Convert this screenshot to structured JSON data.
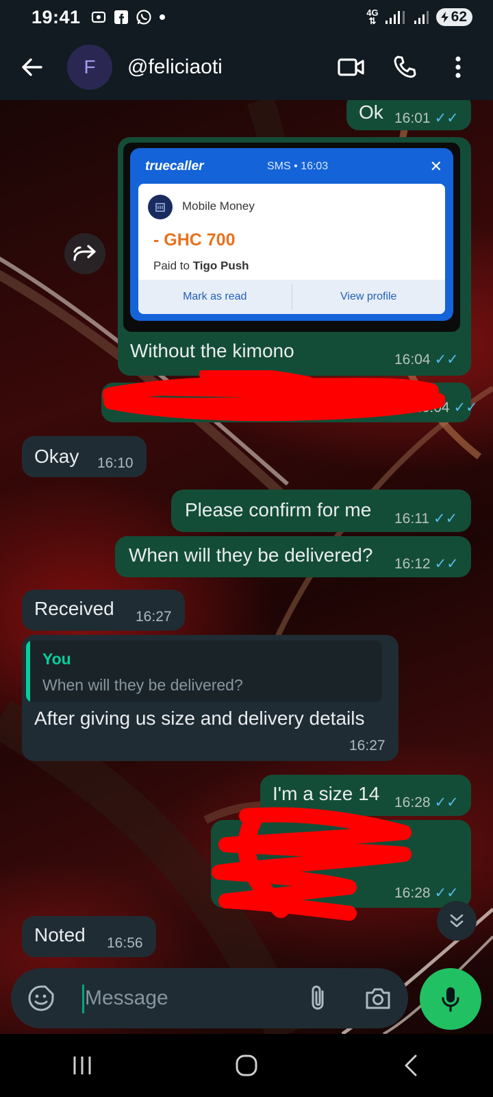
{
  "status_bar": {
    "time": "19:41",
    "network": "4G",
    "battery": "62"
  },
  "header": {
    "avatar_initial": "F",
    "contact": "@feliciaoti"
  },
  "messages": [
    {
      "id": "m1",
      "dir": "out",
      "text": "Ok",
      "time": "16:01",
      "ticks": "✓✓"
    },
    {
      "id": "m2",
      "dir": "out",
      "text": "Without the kimono",
      "time": "16:04",
      "ticks": "✓✓",
      "attachment": {
        "app": "truecaller",
        "meta": "SMS • 16:03",
        "sender": "Mobile Money",
        "amount": "- GHC 700",
        "paid_label": "Paid",
        "paid_to": "to",
        "payee": "Tigo Push",
        "action_read": "Mark as read",
        "action_profile": "View profile"
      }
    },
    {
      "id": "m3",
      "dir": "out",
      "text": "",
      "time": "16:04",
      "ticks": "✓✓",
      "redacted": true
    },
    {
      "id": "m4",
      "dir": "in",
      "text": "Okay",
      "time": "16:10"
    },
    {
      "id": "m5",
      "dir": "out",
      "text": "Please confirm for me",
      "time": "16:11",
      "ticks": "✓✓"
    },
    {
      "id": "m6",
      "dir": "out",
      "text": "When will they be delivered?",
      "time": "16:12",
      "ticks": "✓✓"
    },
    {
      "id": "m7",
      "dir": "in",
      "text": "Received",
      "time": "16:27"
    },
    {
      "id": "m8",
      "dir": "in",
      "text": "After giving us size and delivery details",
      "time": "16:27",
      "quote": {
        "author": "You",
        "text": "When will they be delivered?"
      }
    },
    {
      "id": "m9",
      "dir": "out",
      "text": "I'm a size 14",
      "time": "16:28",
      "ticks": "✓✓"
    },
    {
      "id": "m10",
      "dir": "out",
      "text": "",
      "time": "16:28",
      "ticks": "✓✓",
      "redacted": true
    },
    {
      "id": "m11",
      "dir": "in",
      "text": "Noted",
      "time": "16:56"
    }
  ],
  "composer": {
    "placeholder": "Message"
  },
  "colors": {
    "outgoing_bubble": "#144d37",
    "incoming_bubble": "#202c33",
    "read_ticks": "#53bdeb",
    "accent_green": "#21c063",
    "redaction": "#ff0000"
  }
}
